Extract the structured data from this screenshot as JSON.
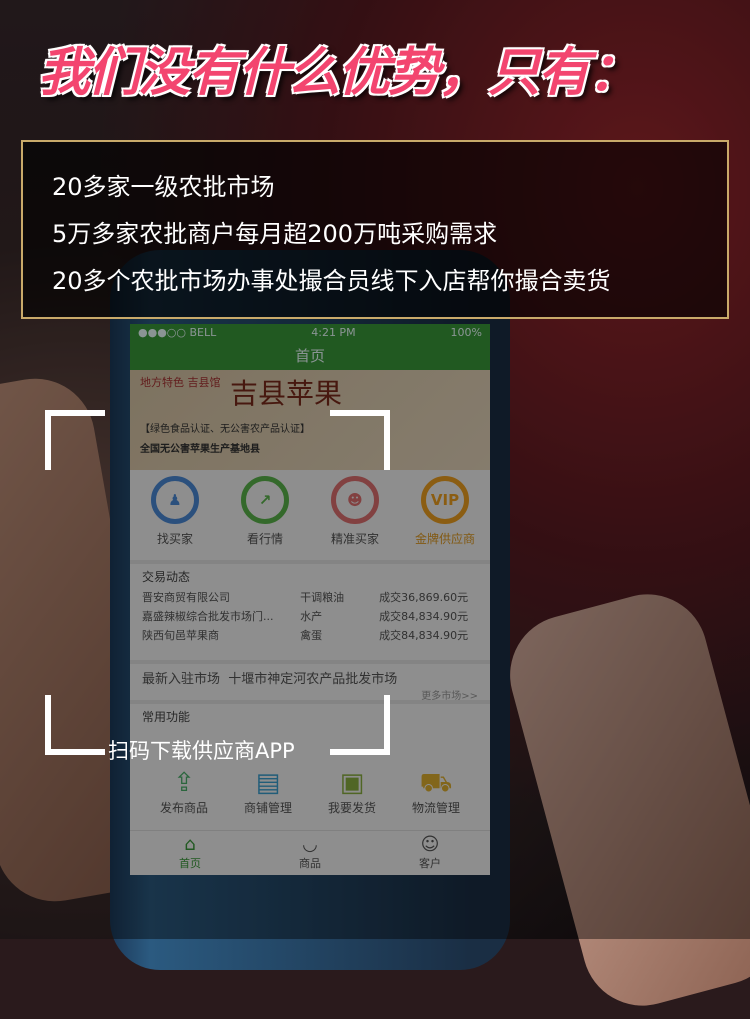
{
  "headline": "我们没有什么优势，只有：",
  "advantages": [
    "20多家一级农批市场",
    "5万多家农批商户每月超200万吨采购需求",
    "20多个农批市场办事处撮合员线下入店帮你撮合卖货"
  ],
  "caption": "扫码下载供应商APP",
  "colors": {
    "headline": "#f3456f",
    "box_border": "#c9aa6a",
    "app_green": "#3a9a3a"
  },
  "phone": {
    "status": {
      "carrier": "●●●○○ BELL",
      "time": "4:21 PM",
      "battery": "100%"
    },
    "title": "首页",
    "banner": {
      "tag": "地方特色 吉县馆",
      "title": "吉县苹果",
      "line1": "【绿色食品认证、无公害农产品认证】",
      "line2": "全国无公害苹果生产基地县"
    },
    "quick": [
      {
        "label": "找买家",
        "icon": "buyer-icon",
        "color": "#4a8ad8"
      },
      {
        "label": "看行情",
        "icon": "trend-icon",
        "color": "#5ab64a"
      },
      {
        "label": "精准买家",
        "icon": "people-icon",
        "color": "#e07070"
      },
      {
        "label": "金牌供应商",
        "icon": "vip-icon",
        "color": "#f0a020"
      }
    ],
    "trade": {
      "title": "交易动态",
      "rows": [
        {
          "company": "晋安商贸有限公司",
          "product": "干调粮油",
          "amount": "成交36,869.60元"
        },
        {
          "company": "嘉盛辣椒综合批发市场门...",
          "product": "水产",
          "amount": "成交84,834.90元"
        },
        {
          "company": "陕西旬邑苹果商",
          "product": "禽蛋",
          "amount": "成交84,834.90元"
        }
      ]
    },
    "new_market": {
      "label": "最新入驻市场",
      "name": "十堰市神定河农产品批发市场",
      "more": "更多市场>>"
    },
    "functions": {
      "title": "常用功能",
      "items": [
        {
          "label": "发布商品",
          "icon": "upload-icon",
          "glyph": "⇪",
          "color": "#4ab06a"
        },
        {
          "label": "商铺管理",
          "icon": "shop-icon",
          "glyph": "▤",
          "color": "#3aa0d0"
        },
        {
          "label": "我要发货",
          "icon": "box-icon",
          "glyph": "▣",
          "color": "#8ab040"
        },
        {
          "label": "物流管理",
          "icon": "truck-icon",
          "glyph": "⛟",
          "color": "#e0b030"
        }
      ]
    },
    "tabs": [
      {
        "label": "首页",
        "glyph": "⌂"
      },
      {
        "label": "商品",
        "glyph": "◡"
      },
      {
        "label": "客户",
        "glyph": "☺"
      }
    ]
  }
}
